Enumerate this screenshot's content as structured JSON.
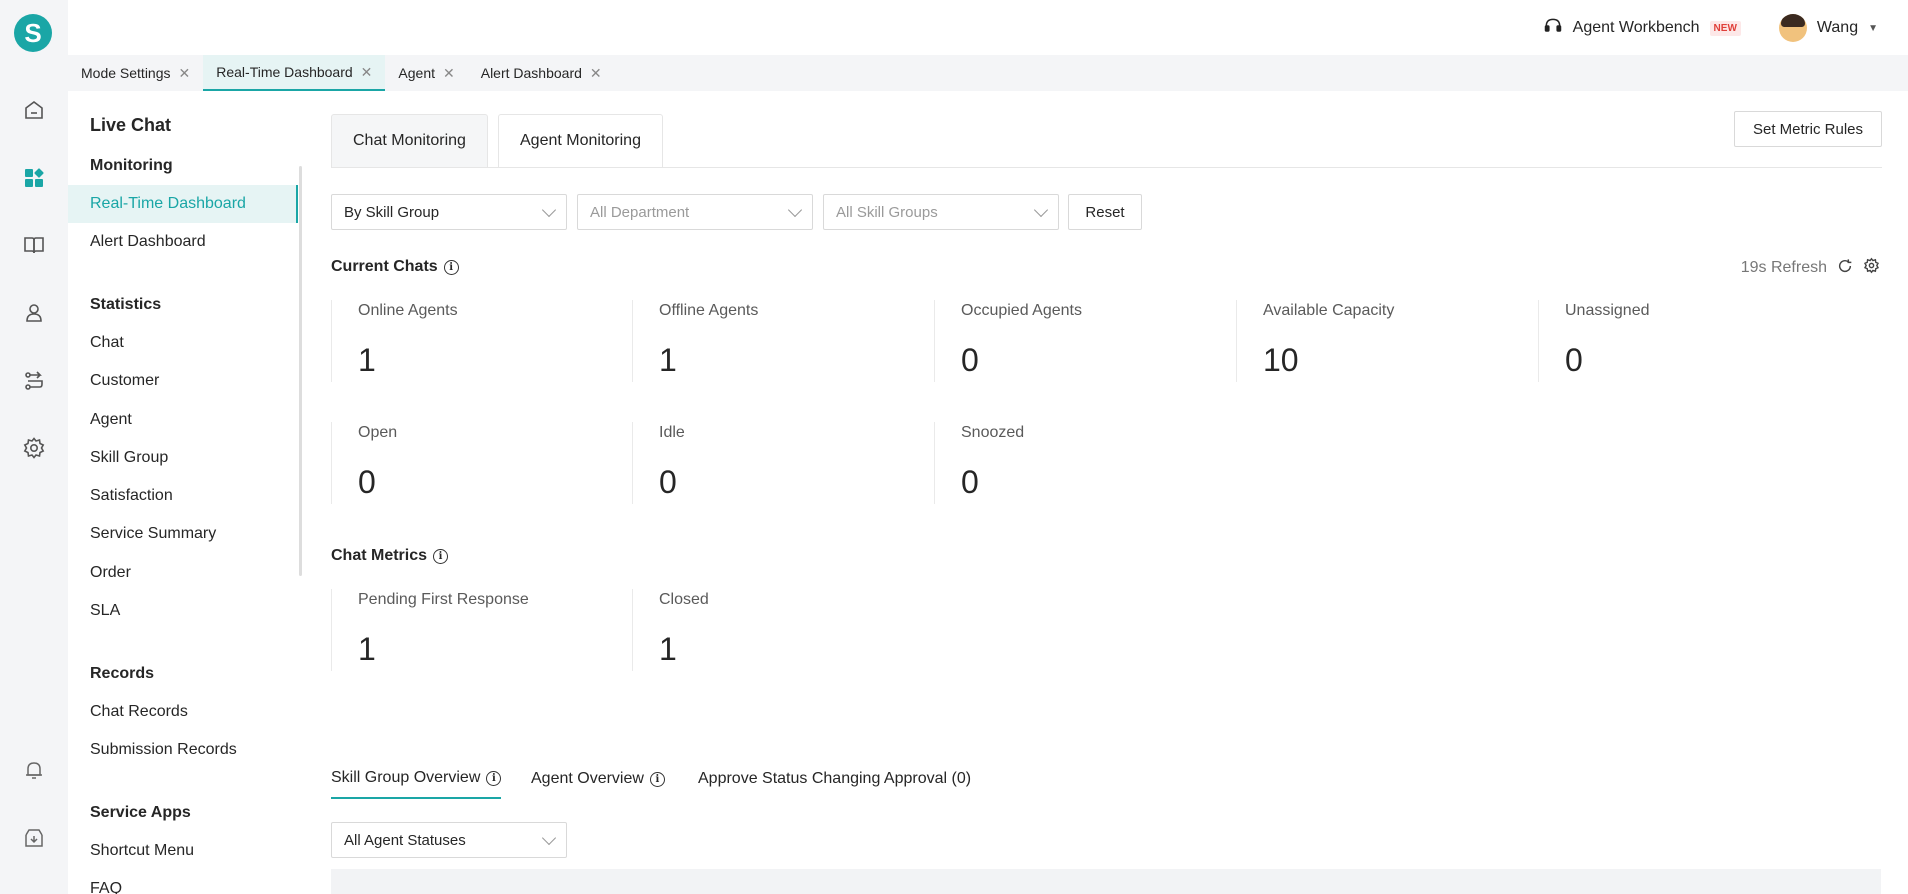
{
  "rail": {
    "logo_letter": "S",
    "icons": [
      "home-icon",
      "dashboard-icon",
      "book-icon",
      "agent-icon",
      "routing-icon",
      "settings-icon",
      "bell-icon",
      "download-icon"
    ]
  },
  "topbar": {
    "workbench_label": "Agent Workbench",
    "new_badge": "NEW",
    "user_name": "Wang"
  },
  "window_tabs": [
    {
      "label": "Mode Settings"
    },
    {
      "label": "Real-Time Dashboard",
      "active": true
    },
    {
      "label": "Agent"
    },
    {
      "label": "Alert Dashboard"
    }
  ],
  "sidebar": {
    "title": "Live Chat",
    "items": [
      {
        "label": "Monitoring",
        "section": true
      },
      {
        "label": "Real-Time Dashboard",
        "active": true
      },
      {
        "label": "Alert Dashboard"
      },
      {
        "label": "Statistics",
        "section": true
      },
      {
        "label": "Chat"
      },
      {
        "label": "Customer"
      },
      {
        "label": "Agent"
      },
      {
        "label": "Skill Group"
      },
      {
        "label": "Satisfaction"
      },
      {
        "label": "Service Summary"
      },
      {
        "label": "Order"
      },
      {
        "label": "SLA"
      },
      {
        "label": "Records",
        "section": true
      },
      {
        "label": "Chat Records"
      },
      {
        "label": "Submission Records"
      },
      {
        "label": "Service Apps",
        "section": true
      },
      {
        "label": "Shortcut Menu"
      },
      {
        "label": "FAQ"
      }
    ]
  },
  "content_tabs": {
    "chat_monitoring": "Chat Monitoring",
    "agent_monitoring": "Agent Monitoring"
  },
  "set_metric_rules": "Set Metric Rules",
  "filters": {
    "group_by": "By Skill Group",
    "department_placeholder": "All Department",
    "skill_groups_placeholder": "All Skill Groups",
    "reset": "Reset"
  },
  "current_chats": {
    "title": "Current Chats",
    "refresh_text": "19s Refresh",
    "metrics": [
      {
        "label": "Online Agents",
        "value": "1"
      },
      {
        "label": "Offline Agents",
        "value": "1"
      },
      {
        "label": "Occupied Agents",
        "value": "0"
      },
      {
        "label": "Available Capacity",
        "value": "10"
      },
      {
        "label": "Unassigned",
        "value": "0"
      },
      {
        "label": "Open",
        "value": "0"
      },
      {
        "label": "Idle",
        "value": "0"
      },
      {
        "label": "Snoozed",
        "value": "0"
      }
    ]
  },
  "chat_metrics": {
    "title": "Chat Metrics",
    "metrics": [
      {
        "label": "Pending First Response",
        "value": "1"
      },
      {
        "label": "Closed",
        "value": "1"
      }
    ]
  },
  "bottom_tabs": {
    "skill_group_overview": "Skill Group Overview",
    "agent_overview": "Agent Overview",
    "approve": "Approve Status Changing Approval (0)"
  },
  "agent_status_filter": "All Agent Statuses"
}
